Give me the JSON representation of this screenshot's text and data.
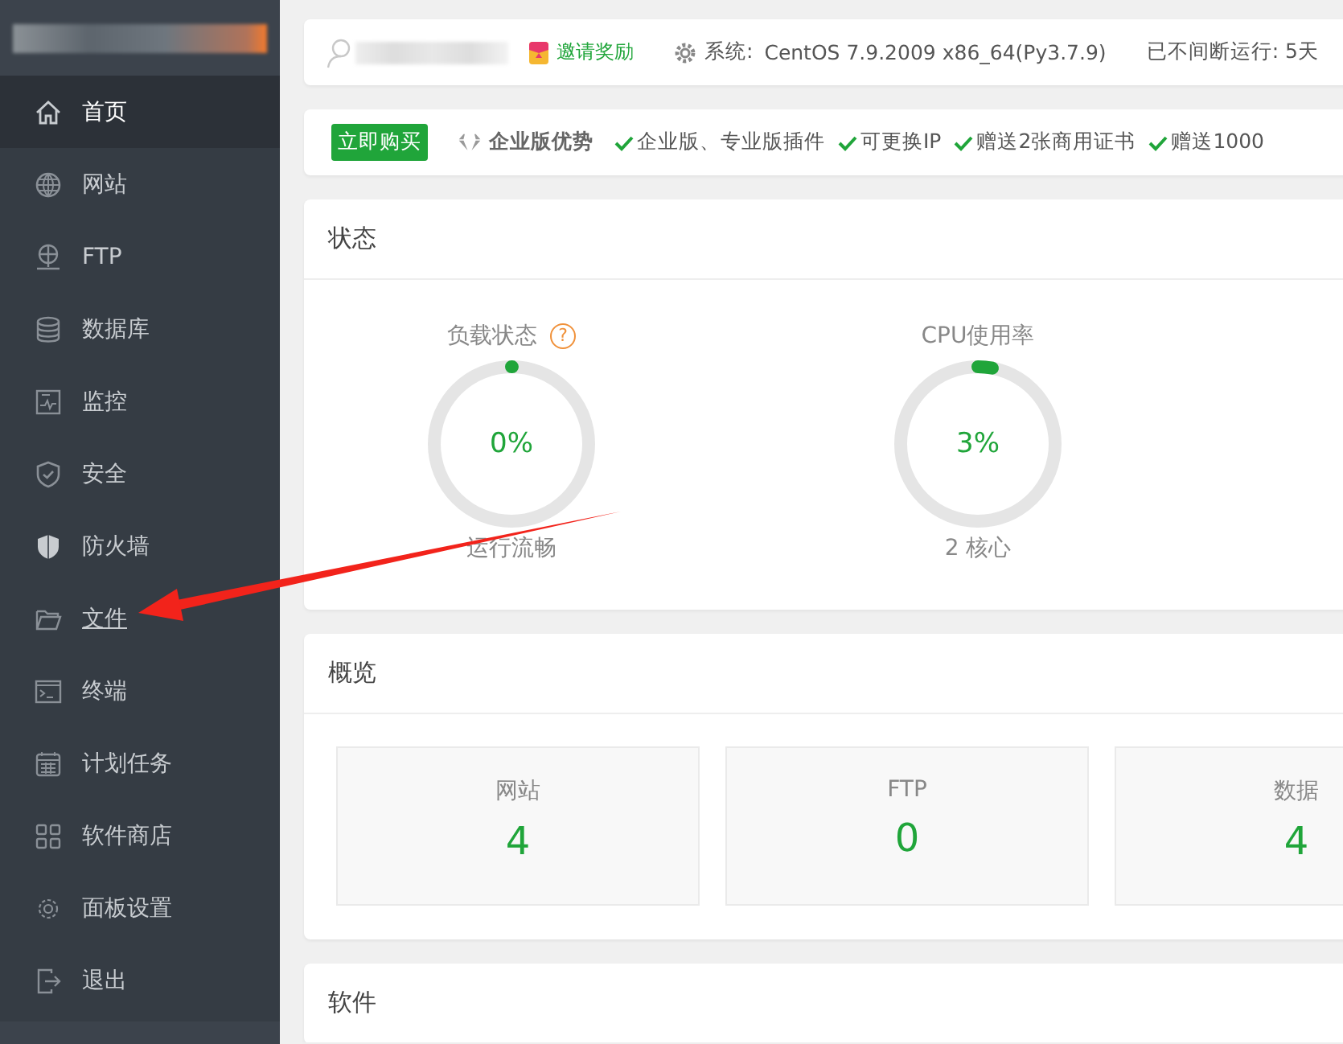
{
  "sidebar": {
    "items": [
      {
        "label": "首页",
        "selected": true,
        "hovered": false
      },
      {
        "label": "网站",
        "selected": false,
        "hovered": false
      },
      {
        "label": "FTP",
        "selected": false,
        "hovered": false
      },
      {
        "label": "数据库",
        "selected": false,
        "hovered": false
      },
      {
        "label": "监控",
        "selected": false,
        "hovered": false
      },
      {
        "label": "安全",
        "selected": false,
        "hovered": false
      },
      {
        "label": "防火墙",
        "selected": false,
        "hovered": false
      },
      {
        "label": "文件",
        "selected": false,
        "hovered": true
      },
      {
        "label": "终端",
        "selected": false,
        "hovered": false
      },
      {
        "label": "计划任务",
        "selected": false,
        "hovered": false
      },
      {
        "label": "软件商店",
        "selected": false,
        "hovered": false
      },
      {
        "label": "面板设置",
        "selected": false,
        "hovered": false
      },
      {
        "label": "退出",
        "selected": false,
        "hovered": false
      }
    ]
  },
  "header": {
    "invite_link": "邀请奖励",
    "system_label": "系统:",
    "system_value": "CentOS 7.9.2009 x86_64(Py3.7.9)",
    "uptime": "已不间断运行: 5天"
  },
  "promo": {
    "buy_button": "立即购买",
    "title": "企业版优势",
    "features": [
      "企业版、专业版插件",
      "可更换IP",
      "赠送2张商用证书",
      "赠送1000"
    ]
  },
  "status": {
    "title": "状态",
    "gauges": [
      {
        "title": "负载状态",
        "help": "?",
        "value": "0%",
        "level": 0,
        "caption": "运行流畅"
      },
      {
        "title": "CPU使用率",
        "value": "3%",
        "level": 0.03,
        "caption": "2 核心"
      }
    ]
  },
  "overview": {
    "title": "概览",
    "stats": [
      {
        "label": "网站",
        "value": "4"
      },
      {
        "label": "FTP",
        "value": "0"
      },
      {
        "label": "数据",
        "value": "4"
      }
    ]
  },
  "software": {
    "title": "软件"
  },
  "annotation": {
    "kind": "arrow"
  }
}
